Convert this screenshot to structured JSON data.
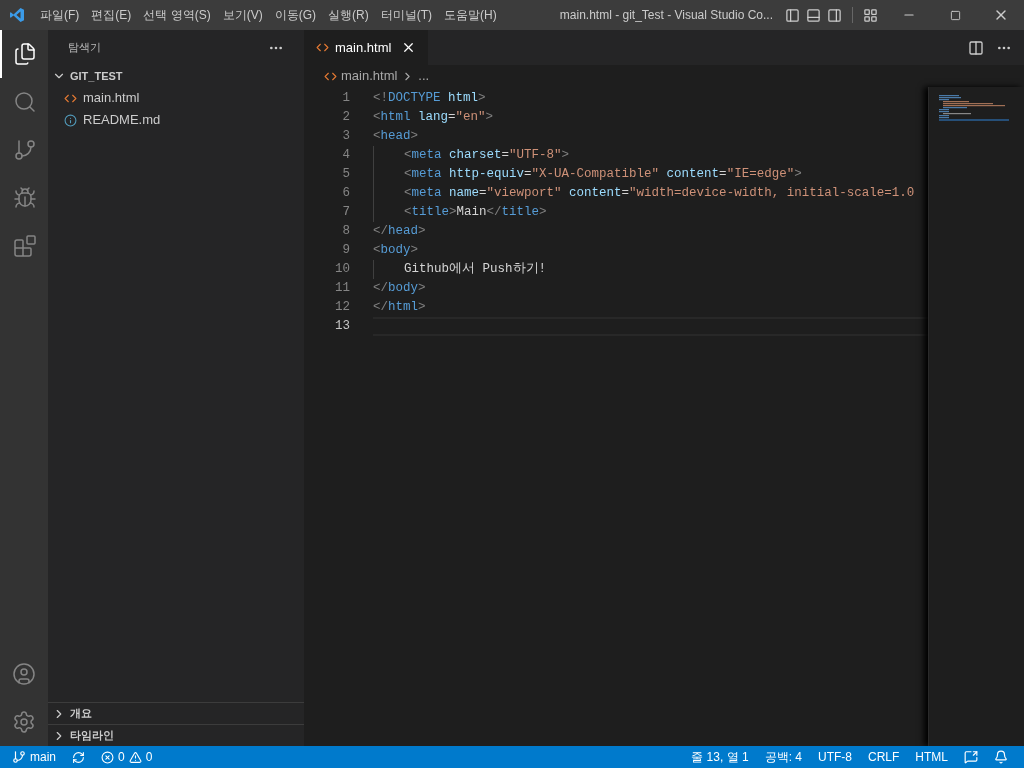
{
  "menu": [
    "파일(F)",
    "편집(E)",
    "선택 영역(S)",
    "보기(V)",
    "이동(G)",
    "실행(R)",
    "터미널(T)",
    "도움말(H)"
  ],
  "window": {
    "title": "main.html - git_Test - Visual Studio Co..."
  },
  "activity_bar": [
    {
      "kind": "explorer",
      "selected": true
    },
    {
      "kind": "search",
      "selected": false
    },
    {
      "kind": "source-control",
      "selected": false
    },
    {
      "kind": "run",
      "selected": false
    },
    {
      "kind": "extensions",
      "selected": false
    }
  ],
  "activity_bar_bottom": [
    {
      "kind": "account"
    },
    {
      "kind": "settings"
    }
  ],
  "sidebar": {
    "title": "탐색기",
    "folder": {
      "name": "GIT_TEST",
      "expanded": true,
      "children": [
        {
          "name": "main.html",
          "kind": "html"
        },
        {
          "name": "README.md",
          "kind": "info"
        }
      ]
    },
    "sections": [
      {
        "name": "개요",
        "expanded": false
      },
      {
        "name": "타임라인",
        "expanded": false
      }
    ]
  },
  "tabs": [
    {
      "label": "main.html",
      "kind": "html",
      "selected": true
    }
  ],
  "breadcrumb": [
    "main.html",
    "..."
  ],
  "editor": {
    "lines": [
      {
        "number": "1",
        "current": false,
        "indent": false,
        "tokens": [
          {
            "kind": "punct",
            "text": "<!"
          },
          {
            "kind": "tag",
            "text": "DOCTYPE"
          },
          {
            "kind": "attr",
            "text": " html"
          },
          {
            "kind": "punct",
            "text": ">"
          }
        ]
      },
      {
        "number": "2",
        "current": false,
        "indent": false,
        "tokens": [
          {
            "kind": "punct",
            "text": "<"
          },
          {
            "kind": "tag",
            "text": "html"
          },
          {
            "kind": "attr",
            "text": " lang"
          },
          {
            "kind": "text",
            "text": "="
          },
          {
            "kind": "str",
            "text": "\"en\""
          },
          {
            "kind": "punct",
            "text": ">"
          }
        ]
      },
      {
        "number": "3",
        "current": false,
        "indent": false,
        "tokens": [
          {
            "kind": "punct",
            "text": "<"
          },
          {
            "kind": "tag",
            "text": "head"
          },
          {
            "kind": "punct",
            "text": ">"
          }
        ]
      },
      {
        "number": "4",
        "current": false,
        "indent": true,
        "tokens": [
          {
            "kind": "punct",
            "text": "<"
          },
          {
            "kind": "tag",
            "text": "meta"
          },
          {
            "kind": "attr",
            "text": " charset"
          },
          {
            "kind": "text",
            "text": "="
          },
          {
            "kind": "str",
            "text": "\"UTF-8\""
          },
          {
            "kind": "punct",
            "text": ">"
          }
        ]
      },
      {
        "number": "5",
        "current": false,
        "indent": true,
        "tokens": [
          {
            "kind": "punct",
            "text": "<"
          },
          {
            "kind": "tag",
            "text": "meta"
          },
          {
            "kind": "attr",
            "text": " http-equiv"
          },
          {
            "kind": "text",
            "text": "="
          },
          {
            "kind": "str",
            "text": "\"X-UA-Compatible\""
          },
          {
            "kind": "attr",
            "text": " content"
          },
          {
            "kind": "text",
            "text": "="
          },
          {
            "kind": "str",
            "text": "\"IE=edge\""
          },
          {
            "kind": "punct",
            "text": ">"
          }
        ]
      },
      {
        "number": "6",
        "current": false,
        "indent": true,
        "tokens": [
          {
            "kind": "punct",
            "text": "<"
          },
          {
            "kind": "tag",
            "text": "meta"
          },
          {
            "kind": "attr",
            "text": " name"
          },
          {
            "kind": "text",
            "text": "="
          },
          {
            "kind": "str",
            "text": "\"viewport\""
          },
          {
            "kind": "attr",
            "text": " content"
          },
          {
            "kind": "text",
            "text": "="
          },
          {
            "kind": "str",
            "text": "\"width=device-width, initial-scale=1.0"
          }
        ]
      },
      {
        "number": "7",
        "current": false,
        "indent": true,
        "tokens": [
          {
            "kind": "punct",
            "text": "<"
          },
          {
            "kind": "tag",
            "text": "title"
          },
          {
            "kind": "punct",
            "text": ">"
          },
          {
            "kind": "text",
            "text": "Main"
          },
          {
            "kind": "punct",
            "text": "</"
          },
          {
            "kind": "tag",
            "text": "title"
          },
          {
            "kind": "punct",
            "text": ">"
          }
        ]
      },
      {
        "number": "8",
        "current": false,
        "indent": false,
        "tokens": [
          {
            "kind": "punct",
            "text": "</"
          },
          {
            "kind": "tag",
            "text": "head"
          },
          {
            "kind": "punct",
            "text": ">"
          }
        ]
      },
      {
        "number": "9",
        "current": false,
        "indent": false,
        "tokens": [
          {
            "kind": "punct",
            "text": "<"
          },
          {
            "kind": "tag",
            "text": "body"
          },
          {
            "kind": "punct",
            "text": ">"
          }
        ]
      },
      {
        "number": "10",
        "current": false,
        "indent": true,
        "tokens": [
          {
            "kind": "text",
            "text": "Github에서 Push하기!"
          }
        ]
      },
      {
        "number": "11",
        "current": false,
        "indent": false,
        "tokens": [
          {
            "kind": "punct",
            "text": "</"
          },
          {
            "kind": "tag",
            "text": "body"
          },
          {
            "kind": "punct",
            "text": ">"
          }
        ]
      },
      {
        "number": "12",
        "current": false,
        "indent": false,
        "tokens": [
          {
            "kind": "punct",
            "text": "</"
          },
          {
            "kind": "tag",
            "text": "html"
          },
          {
            "kind": "punct",
            "text": ">"
          }
        ]
      },
      {
        "number": "13",
        "current": true,
        "indent": false
      }
    ]
  },
  "status_bar": {
    "branch": "main",
    "errors": "0",
    "warnings": "0",
    "right": [
      "줄 13, 열 1",
      "공백: 4",
      "UTF-8",
      "CRLF",
      "HTML"
    ]
  }
}
